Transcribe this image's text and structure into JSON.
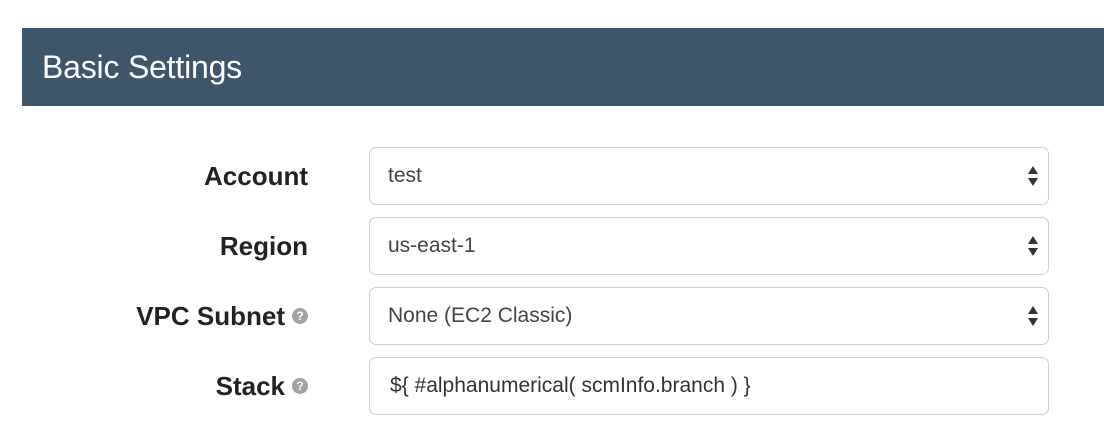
{
  "header": {
    "title": "Basic Settings"
  },
  "form": {
    "fields": [
      {
        "label": "Account",
        "value": "test",
        "type": "select",
        "has_help": false
      },
      {
        "label": "Region",
        "value": "us-east-1",
        "type": "select",
        "has_help": false
      },
      {
        "label": "VPC Subnet",
        "value": "None (EC2 Classic)",
        "type": "select",
        "has_help": true
      },
      {
        "label": "Stack",
        "value": "${ #alphanumerical( scmInfo.branch ) }",
        "type": "text",
        "has_help": true
      }
    ]
  },
  "icons": {
    "help": "question-circle-icon",
    "select": "select-up-down-arrows-icon"
  },
  "colors": {
    "header_bg": "#3d566b",
    "header_text": "#ffffff",
    "label_text": "#222222",
    "field_border": "#cfcfcf",
    "help_icon": "#a3a3a3"
  }
}
